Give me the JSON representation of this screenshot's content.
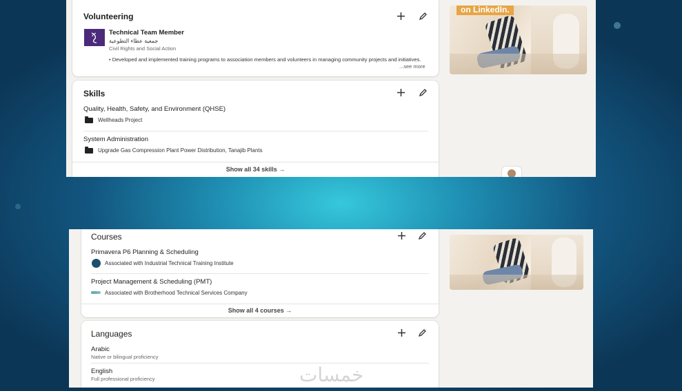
{
  "top_panel": {
    "ad_text": "on LinkedIn.",
    "volunteering": {
      "title": "Volunteering",
      "role": "Technical Team Member",
      "org": "جمعية عطاء التطوعية",
      "cause": "Civil Rights and Social Action",
      "description": "• Developed and implemented training programs to association members and volunteers in managing community projects and initiatives.",
      "see_more": "...see more"
    },
    "skills": {
      "title": "Skills",
      "items": [
        {
          "name": "Quality, Health, Safety, and Environment (QHSE)",
          "project": "Wellheads Project"
        },
        {
          "name": "System Administration",
          "project": "Upgrade Gas Compression Plant Power Distribution, Tanajib Plants"
        }
      ],
      "show_all": "Show all 34 skills →"
    }
  },
  "bottom_panel": {
    "courses": {
      "title": "Courses",
      "items": [
        {
          "name": "Primavera P6 Planning & Scheduling",
          "assoc": "Associated with Industrial Technical Training Institute"
        },
        {
          "name": "Project Management & Scheduling (PMT)",
          "assoc": "Associated with Brotherhood Technical Services Company"
        }
      ],
      "show_all": "Show all 4 courses →"
    },
    "languages": {
      "title": "Languages",
      "items": [
        {
          "name": "Arabic",
          "level": "Native or bilingual proficiency"
        },
        {
          "name": "English",
          "level": "Full professional proficiency"
        }
      ]
    },
    "watermark": "خمسات"
  }
}
